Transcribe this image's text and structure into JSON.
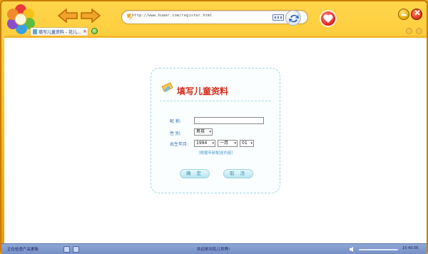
{
  "toolbar": {
    "address": "http://www.huaer.com/register.html"
  },
  "tab": {
    "label": "填写儿童资料 - 花儿…",
    "close": "×"
  },
  "form": {
    "title": "填写儿童资料",
    "nick_label": "昵    称:",
    "nick_value": "",
    "sex_label": "性    别:",
    "sex_value": "男孩",
    "birth_label": "出生年月:",
    "year_value": "1994",
    "month_value": "一月",
    "day_value": "01",
    "hint": "（根据年龄配送内容）",
    "ok_label": "确 定",
    "cancel_label": "取 消"
  },
  "status": {
    "left_text": "正在检查产品更新",
    "center_text": "欢迎来到花儿世界!",
    "time": "15:40:56"
  },
  "colors": {
    "accent": "#f7b515",
    "title_red": "#d42c1a",
    "form_blue": "#3a6fb0",
    "statusbar": "#7f98cd"
  }
}
